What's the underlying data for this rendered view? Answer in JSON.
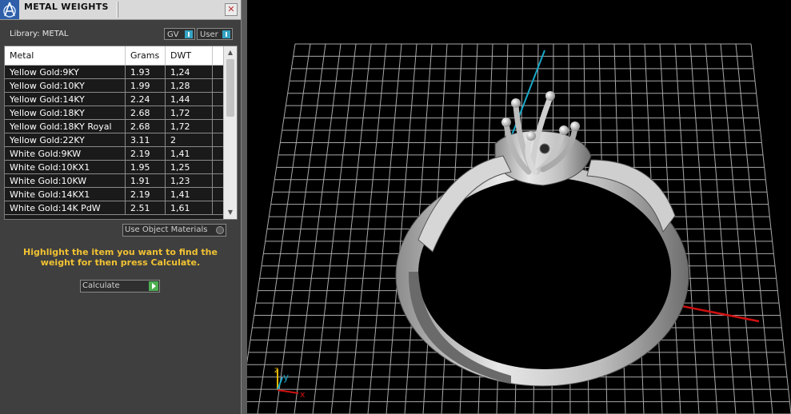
{
  "panel": {
    "title": "METAL WEIGHTS",
    "close_label": "✕",
    "library_label": "Library: METAL",
    "toggle_gv": "GV",
    "toggle_user": "User",
    "use_object_materials": "Use Object Materials",
    "hint": "Highlight the item you want to find the weight for then press Calculate.",
    "calculate_label": "Calculate"
  },
  "table": {
    "headers": [
      "Metal",
      "Grams",
      "DWT"
    ],
    "rows": [
      {
        "metal": "Yellow Gold:9KY",
        "grams": "1.93",
        "dwt": "1,24"
      },
      {
        "metal": "Yellow Gold:10KY",
        "grams": "1.99",
        "dwt": "1,28"
      },
      {
        "metal": "Yellow Gold:14KY",
        "grams": "2.24",
        "dwt": "1,44"
      },
      {
        "metal": "Yellow Gold:18KY",
        "grams": "2.68",
        "dwt": "1,72"
      },
      {
        "metal": "Yellow Gold:18KY Royal",
        "grams": "2.68",
        "dwt": "1,72"
      },
      {
        "metal": "Yellow Gold:22KY",
        "grams": "3.11",
        "dwt": "2"
      },
      {
        "metal": "White Gold:9KW",
        "grams": "2.19",
        "dwt": "1,41"
      },
      {
        "metal": "White Gold:10KX1",
        "grams": "1.95",
        "dwt": "1,25"
      },
      {
        "metal": "White Gold:10KW",
        "grams": "1.91",
        "dwt": "1,23"
      },
      {
        "metal": "White Gold:14KX1",
        "grams": "2.19",
        "dwt": "1,41"
      },
      {
        "metal": "White Gold:14K PdW",
        "grams": "2.51",
        "dwt": "1,61"
      }
    ]
  },
  "viewport": {
    "axis_labels": {
      "x": "x",
      "y": "y",
      "z": "z"
    },
    "colors": {
      "grid": "#a8a8a8",
      "x_axis": "#d01010",
      "y_axis": "#18a8c8",
      "ring": "#c8c8c8"
    }
  }
}
